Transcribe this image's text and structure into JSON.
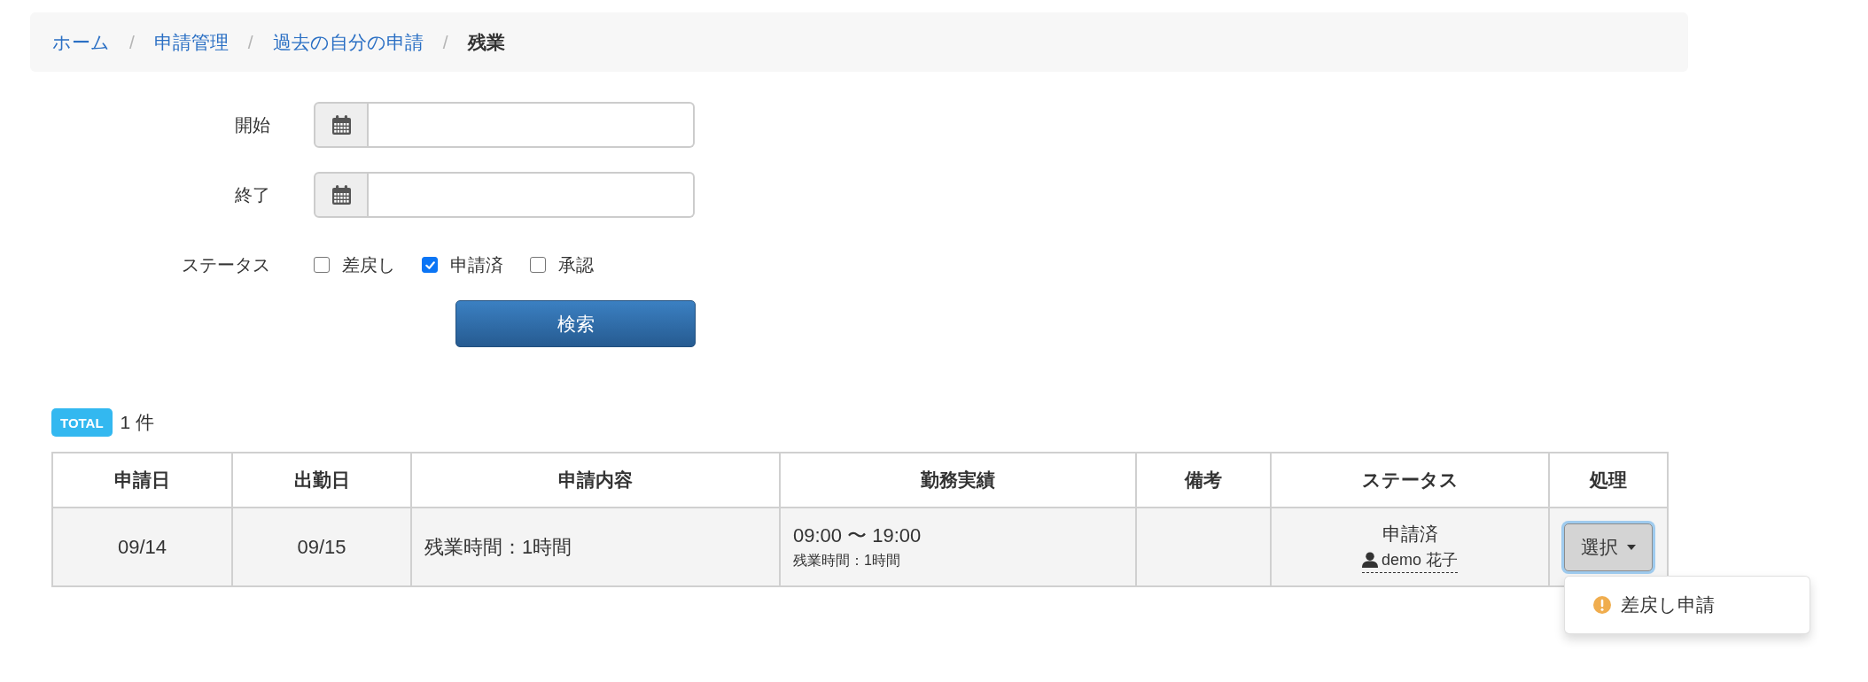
{
  "breadcrumb": [
    {
      "label": "ホーム",
      "kind": "link"
    },
    {
      "label": "申請管理",
      "kind": "link",
      "separator": "/"
    },
    {
      "label": "過去の自分の申請",
      "kind": "link",
      "separator": "/"
    },
    {
      "label": "残業",
      "kind": "current",
      "separator": "/"
    }
  ],
  "filter": {
    "date_fields": [
      {
        "label": "開始"
      },
      {
        "label": "終了"
      }
    ],
    "status": {
      "label": "ステータス",
      "options": [
        {
          "label": "差戻し",
          "checked": false
        },
        {
          "label": "申請済",
          "checked": true
        },
        {
          "label": "承認",
          "checked": false
        }
      ]
    },
    "search_button": "検索"
  },
  "summary": {
    "badge": "TOTAL",
    "count": "1 件"
  },
  "table": {
    "columns": [
      "申請日",
      "出勤日",
      "申請内容",
      "勤務実績",
      "備考",
      "ステータス",
      "処理"
    ],
    "rows": [
      {
        "application_date": "09/14",
        "work_date": "09/15",
        "content": "残業時間：1時間",
        "work_record": {
          "time": "09:00 〜 19:00",
          "overtime": "残業時間：1時間"
        },
        "status": "申請済",
        "applicant": "demo 花子",
        "action": {
          "label": "選択",
          "expanded": true,
          "menu": [
            {
              "label": "差戻し申請"
            }
          ]
        }
      }
    ]
  }
}
